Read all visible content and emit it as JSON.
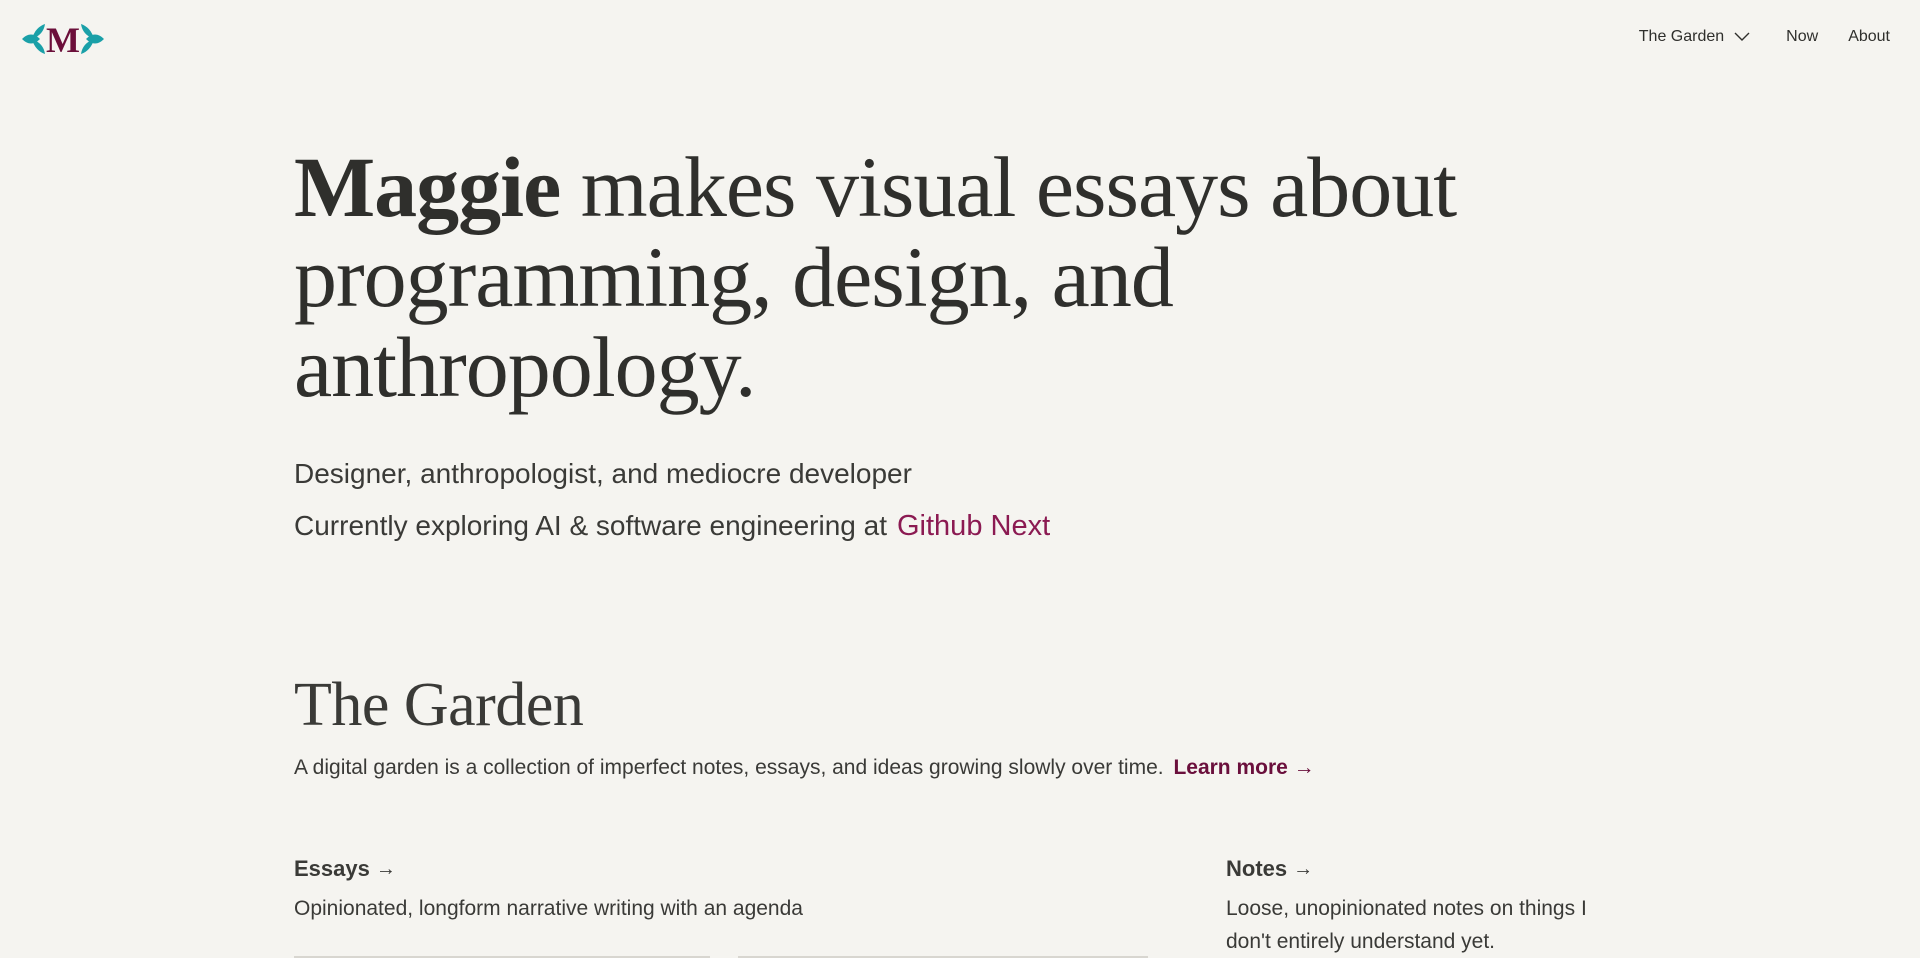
{
  "nav": {
    "garden_label": "The Garden",
    "now_label": "Now",
    "about_label": "About"
  },
  "hero": {
    "name": "Maggie",
    "line_rest": " makes visual essays about programming, design, and anthropology."
  },
  "taglines": {
    "line1": "Designer, anthropologist, and mediocre developer",
    "line2": "Currently exploring AI & software engineering at",
    "line2_link": "Github Next"
  },
  "garden": {
    "title": "The Garden",
    "description": "A digital garden is a collection of imperfect notes, essays, and ideas growing slowly over time.",
    "learn_more": "Learn more",
    "arrow": "→",
    "essays": {
      "title": "Essays",
      "description": "Opinionated, longform narrative writing with an agenda"
    },
    "notes": {
      "title": "Notes",
      "description": "Loose, unopinionated notes on things I don't entirely understand yet."
    }
  },
  "colors": {
    "background": "#f5f4f0",
    "text": "#2f2f2c",
    "accent": "#8b1a52",
    "logo_teal": "#1aa0a8",
    "logo_maroon": "#6b0f3a"
  },
  "icons": {
    "logo": "maggie-m-logo",
    "nav_chevron": "chevron-down-icon",
    "arrow": "arrow-right-icon"
  }
}
